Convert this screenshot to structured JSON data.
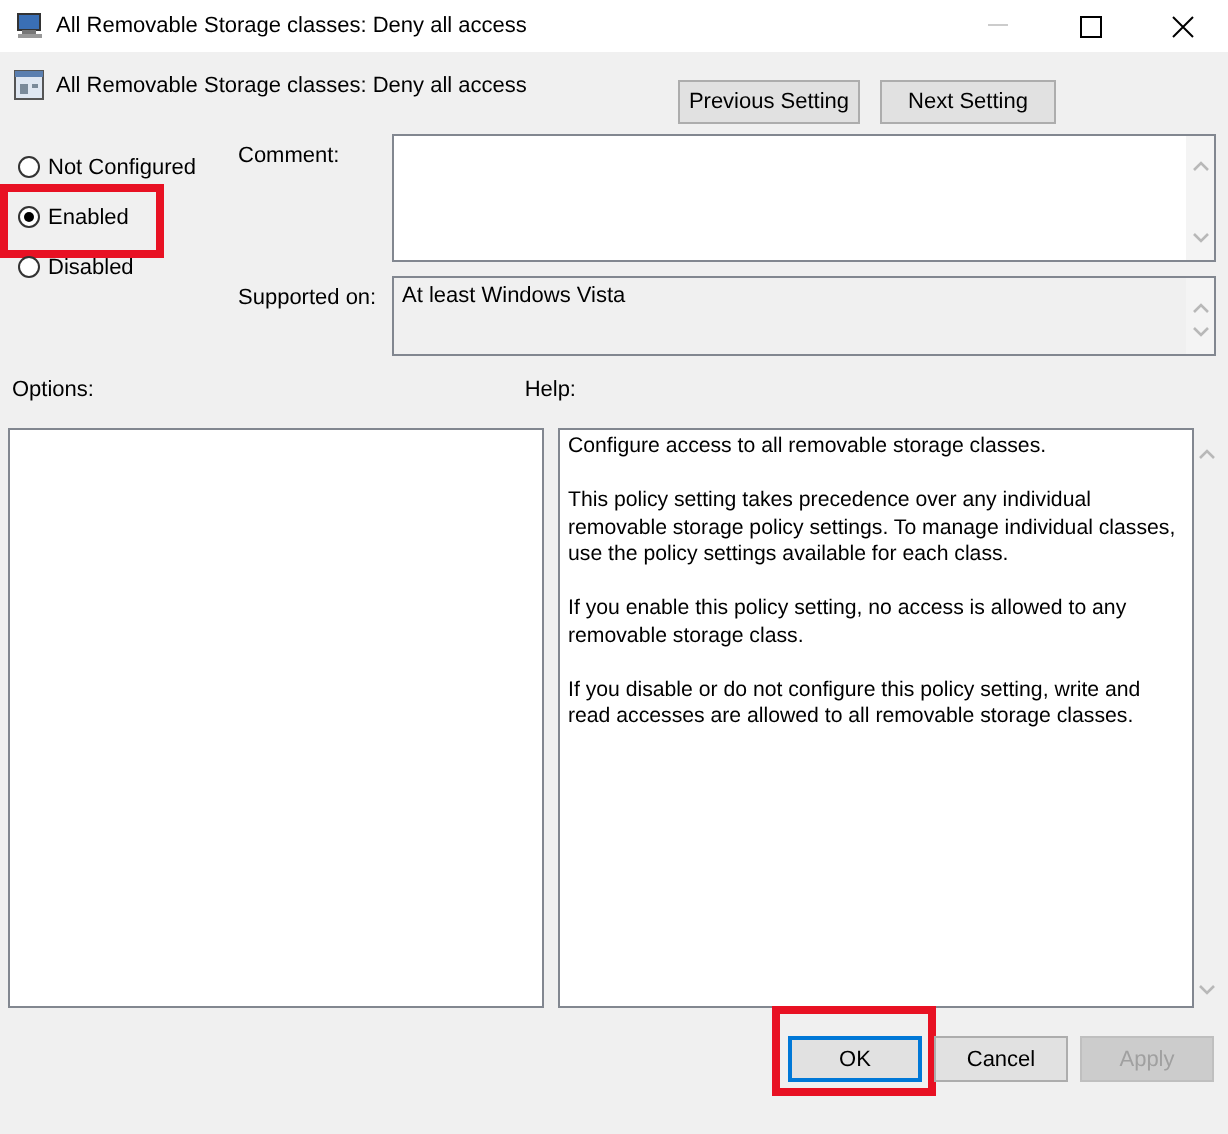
{
  "window": {
    "title": "All Removable Storage classes: Deny all access"
  },
  "header": {
    "title": "All Removable Storage classes: Deny all access",
    "buttons": [
      {
        "label": "Previous Setting"
      },
      {
        "label": "Next Setting"
      }
    ]
  },
  "state_options": [
    {
      "label": "Not Configured",
      "selected": false,
      "highlighted": false
    },
    {
      "label": "Enabled",
      "selected": true,
      "highlighted": true
    },
    {
      "label": "Disabled",
      "selected": false,
      "highlighted": false
    }
  ],
  "comment": {
    "label": "Comment:"
  },
  "supported_on": {
    "label": "Supported on:",
    "value": "At least Windows Vista"
  },
  "options": {
    "label": "Options:"
  },
  "help": {
    "label": "Help:",
    "paragraphs": [
      "Configure access to all removable storage classes.",
      "This policy setting takes precedence over any individual removable storage policy settings. To manage individual classes, use the policy settings available for each class.",
      "If you enable this policy setting, no access is allowed to any removable storage class.",
      "If you disable or do not configure this policy setting, write and read accesses are allowed to all removable storage classes."
    ]
  },
  "buttons": [
    {
      "label": "OK",
      "default": true,
      "disabled": false,
      "highlighted": true
    },
    {
      "label": "Cancel",
      "default": false,
      "disabled": false,
      "highlighted": false
    },
    {
      "label": "Apply",
      "default": false,
      "disabled": true,
      "highlighted": false
    }
  ]
}
